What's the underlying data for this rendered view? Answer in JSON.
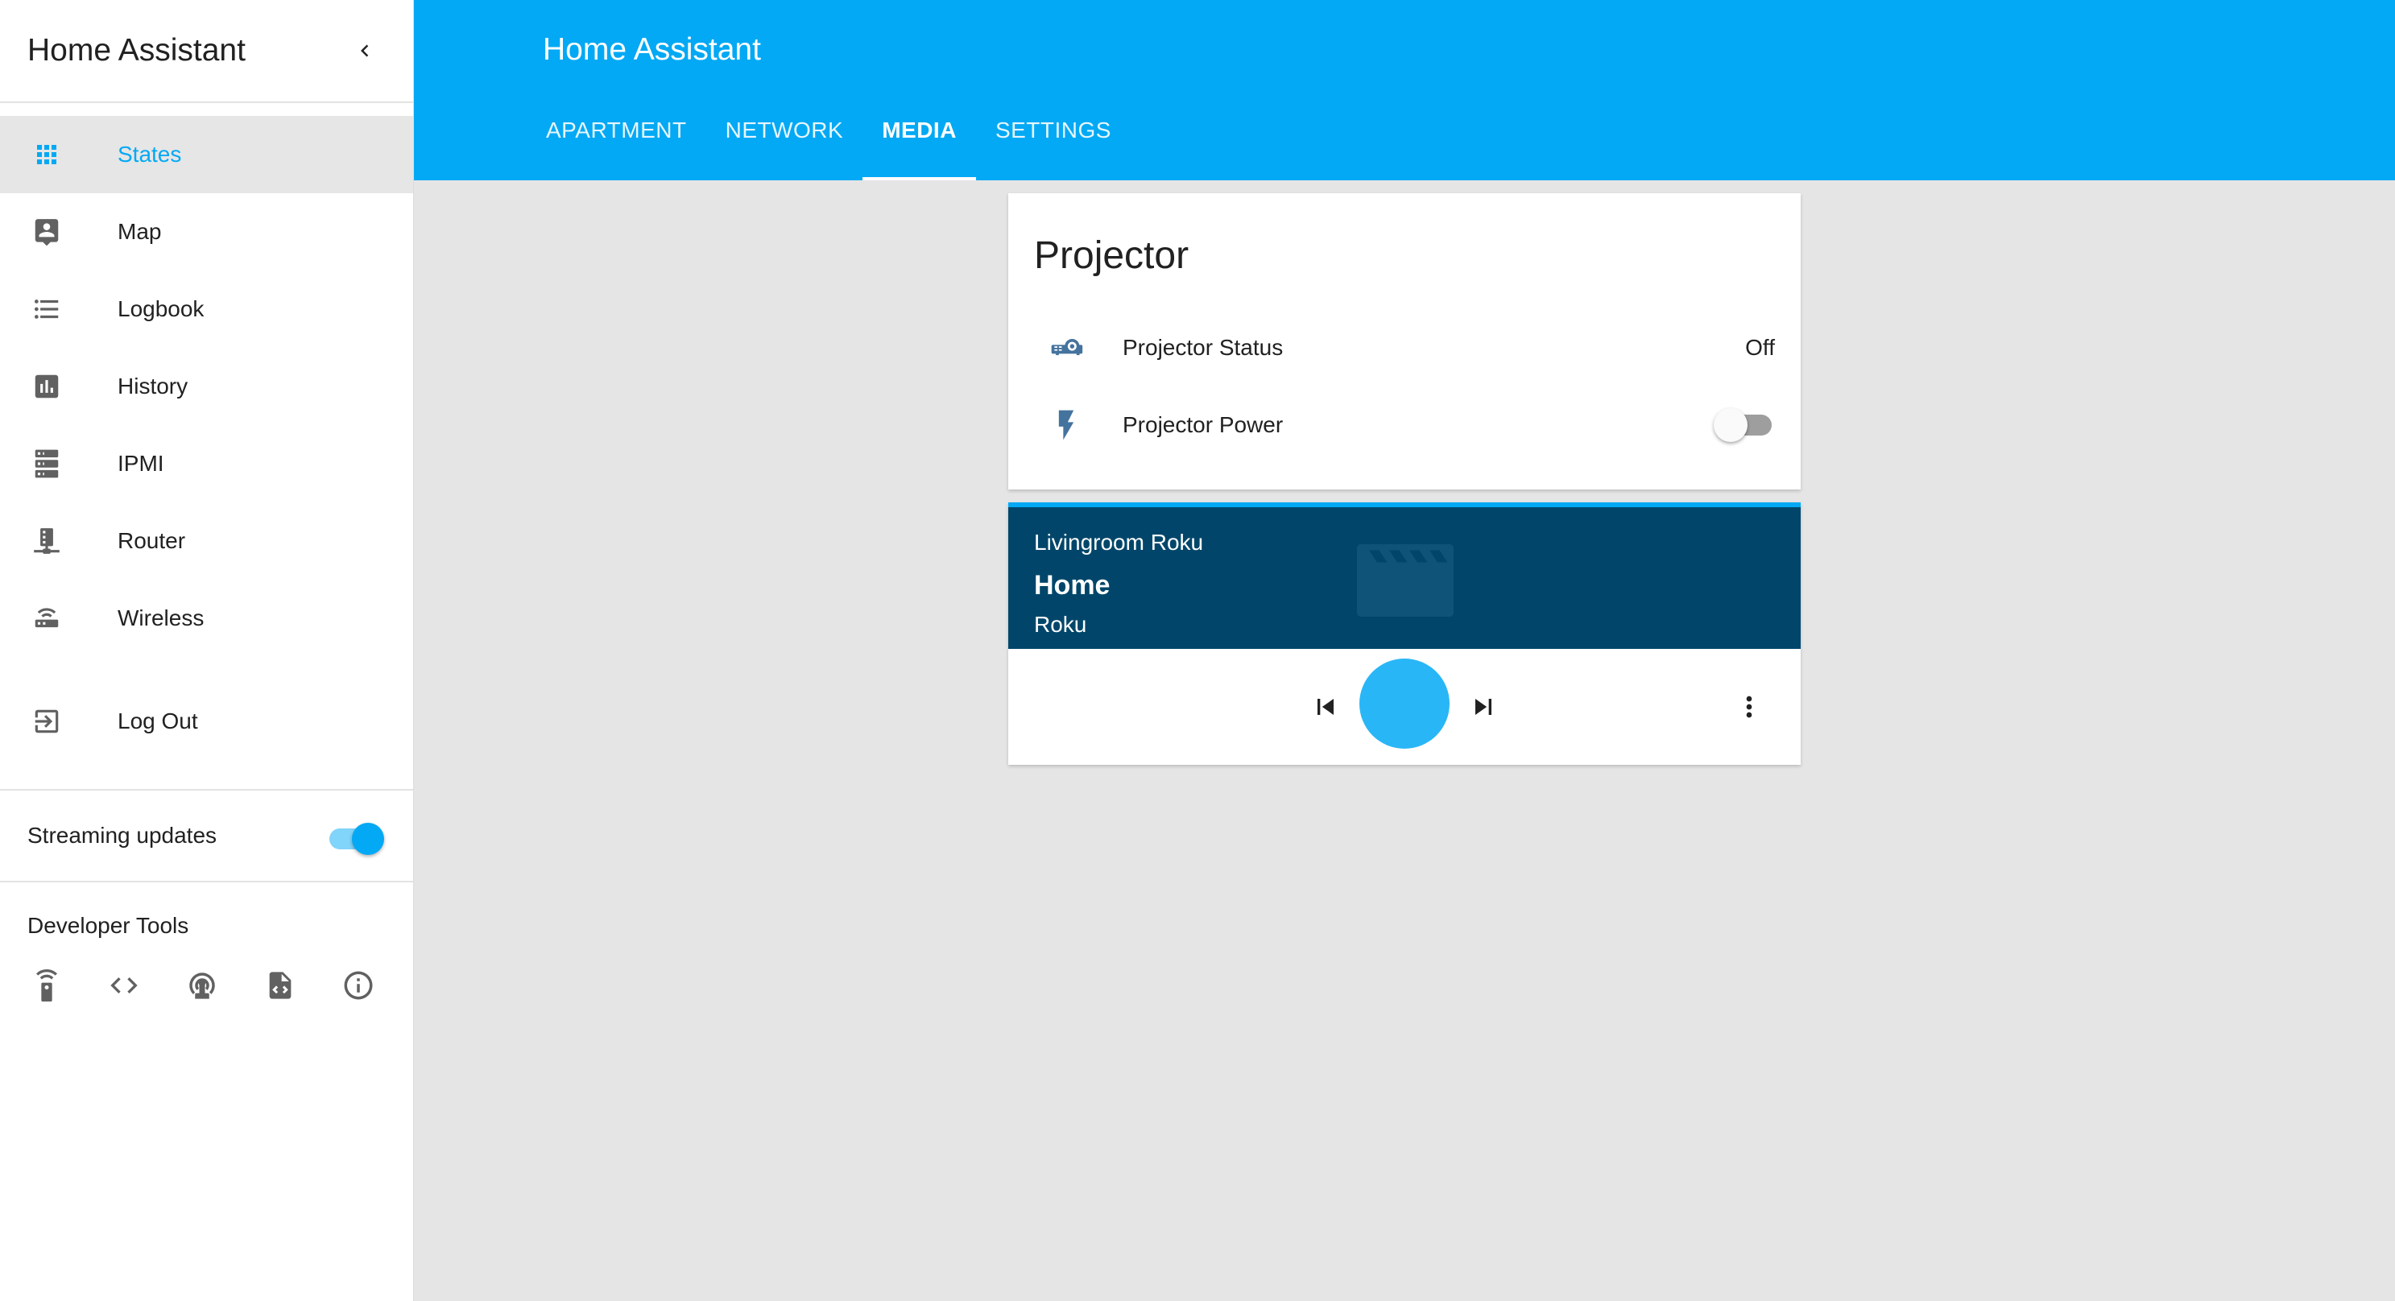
{
  "sidebar": {
    "title": "Home Assistant",
    "items": [
      {
        "label": "States",
        "icon": "apps-icon",
        "active": true
      },
      {
        "label": "Map",
        "icon": "account-box-icon"
      },
      {
        "label": "Logbook",
        "icon": "format-list-icon"
      },
      {
        "label": "History",
        "icon": "chart-box-icon"
      },
      {
        "label": "IPMI",
        "icon": "server-icon"
      },
      {
        "label": "Router",
        "icon": "server-network-icon"
      },
      {
        "label": "Wireless",
        "icon": "router-wireless-icon"
      }
    ],
    "logout_label": "Log Out",
    "streaming_label": "Streaming updates",
    "streaming_enabled": true,
    "devtools_title": "Developer Tools",
    "devtools_icons": [
      "remote-icon",
      "code-tags-icon",
      "podcast-icon",
      "file-xml-icon",
      "info-outline-icon"
    ]
  },
  "header": {
    "title": "Home Assistant",
    "tabs": [
      {
        "label": "APARTMENT"
      },
      {
        "label": "NETWORK"
      },
      {
        "label": "MEDIA",
        "active": true
      },
      {
        "label": "SETTINGS"
      }
    ]
  },
  "projector_card": {
    "title": "Projector",
    "status_label": "Projector Status",
    "status_value": "Off",
    "power_label": "Projector Power",
    "power_on": false
  },
  "media_card": {
    "name": "Livingroom Roku",
    "media_title": "Home",
    "source": "Roku"
  },
  "colors": {
    "primary": "#03a9f4",
    "media_bg": "#01466a",
    "icon": "#44739e"
  }
}
